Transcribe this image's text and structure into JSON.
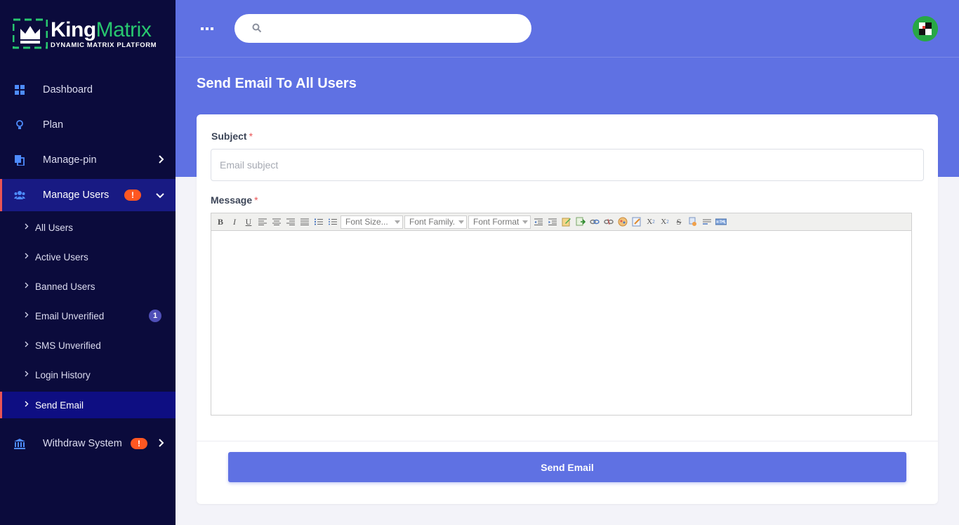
{
  "brand": {
    "name_part1": "King",
    "name_part2": "Matrix",
    "tagline": "DYNAMIC MATRIX PLATFORM",
    "accent_color": "#28c76f"
  },
  "sidebar": {
    "items": [
      {
        "label": "Dashboard",
        "icon": "dashboard-grid-icon"
      },
      {
        "label": "Plan",
        "icon": "lightbulb-icon"
      },
      {
        "label": "Manage-pin",
        "icon": "copy-icon"
      },
      {
        "label": "Manage Users",
        "icon": "users-icon",
        "badge": "!"
      },
      {
        "label": "Withdraw System",
        "icon": "bank-icon",
        "badge": "!"
      }
    ],
    "submenu": [
      {
        "label": "All Users"
      },
      {
        "label": "Active Users"
      },
      {
        "label": "Banned Users"
      },
      {
        "label": "Email Unverified",
        "badge": "1"
      },
      {
        "label": "SMS Unverified"
      },
      {
        "label": "Login History"
      },
      {
        "label": "Send Email"
      }
    ]
  },
  "header": {
    "search_placeholder": "",
    "background_color": "#5f71e3"
  },
  "page": {
    "title": "Send Email To All Users"
  },
  "form": {
    "subject_label": "Subject",
    "subject_placeholder": "Email subject",
    "subject_value": "",
    "message_label": "Message",
    "required_mark": "*",
    "toolbar": {
      "font_size": "Font Size...",
      "font_family": "Font Family.",
      "font_format": "Font Format"
    },
    "submit_label": "Send Email"
  }
}
